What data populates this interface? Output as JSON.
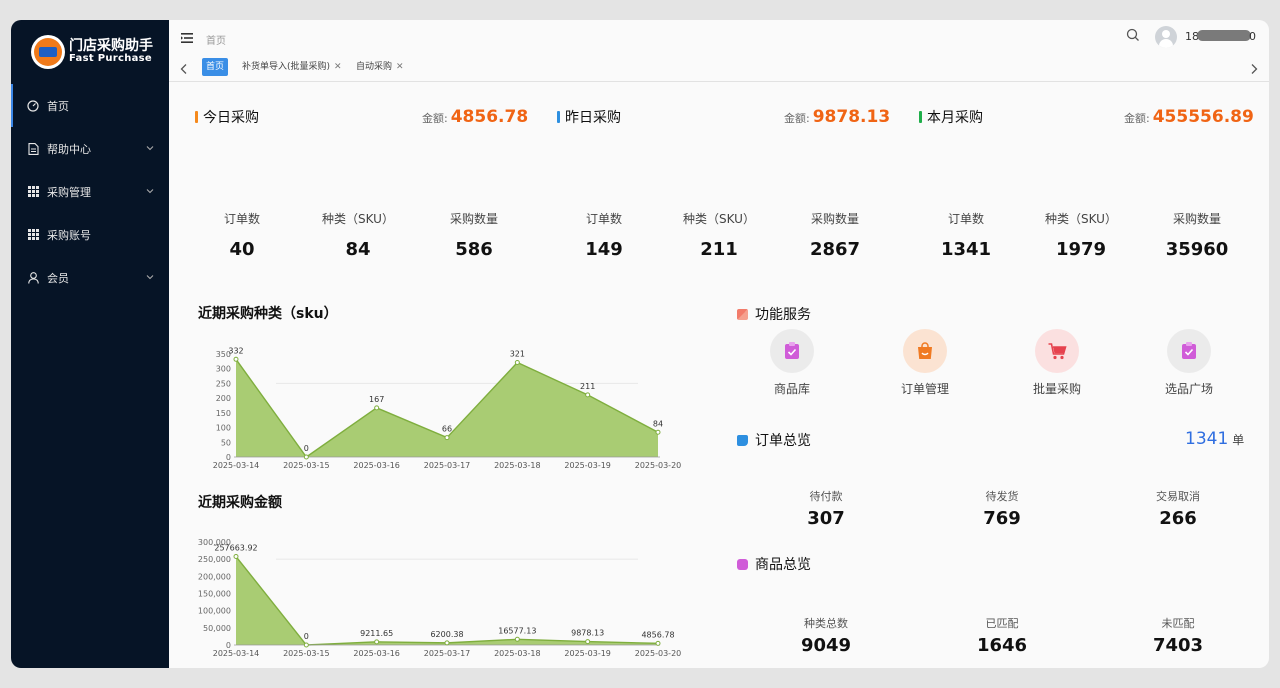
{
  "app": {
    "title_cn": "门店采购助手",
    "title_en": "Fast Purchase"
  },
  "sidebar": {
    "items": [
      {
        "label": "首页",
        "icon": "dashboard-icon",
        "active": true
      },
      {
        "label": "帮助中心",
        "icon": "document-icon",
        "active": false
      },
      {
        "label": "采购管理",
        "icon": "grid-icon",
        "active": false
      },
      {
        "label": "采购账号",
        "icon": "grid-icon",
        "active": false
      },
      {
        "label": "会员",
        "icon": "user-icon",
        "active": false
      }
    ]
  },
  "header": {
    "breadcrumb": "首页",
    "username_start": "18",
    "username_end": "0"
  },
  "tabs": [
    {
      "label": "首页",
      "active": true,
      "closable": false
    },
    {
      "label": "补货单导入(批量采购)",
      "active": false,
      "closable": true
    },
    {
      "label": "自动采购",
      "active": false,
      "closable": true
    }
  ],
  "stats": [
    {
      "title": "今日采购",
      "accent": "#f5891c",
      "amount_label": "金额:",
      "amount": "4856.78",
      "metrics": [
        {
          "label": "订单数",
          "value": "40"
        },
        {
          "label": "种类（SKU）",
          "value": "84"
        },
        {
          "label": "采购数量",
          "value": "586"
        }
      ]
    },
    {
      "title": "昨日采购",
      "accent": "#2d8fe0",
      "amount_label": "金额:",
      "amount": "9878.13",
      "metrics": [
        {
          "label": "订单数",
          "value": "149"
        },
        {
          "label": "种类（SKU）",
          "value": "211"
        },
        {
          "label": "采购数量",
          "value": "2867"
        }
      ]
    },
    {
      "title": "本月采购",
      "accent": "#1fae4a",
      "amount_label": "金额:",
      "amount": "455556.89",
      "metrics": [
        {
          "label": "订单数",
          "value": "1341"
        },
        {
          "label": "种类（SKU）",
          "value": "1979"
        },
        {
          "label": "采购数量",
          "value": "35960"
        }
      ]
    }
  ],
  "chart_data": [
    {
      "type": "area",
      "title": "近期采购种类（sku）",
      "categories": [
        "2025-03-14",
        "2025-03-15",
        "2025-03-16",
        "2025-03-17",
        "2025-03-18",
        "2025-03-19",
        "2025-03-20"
      ],
      "values": [
        332,
        0,
        167,
        66,
        321,
        211,
        84
      ],
      "value_labels": [
        "332",
        "0",
        "167",
        "66",
        "321",
        "211",
        "84"
      ],
      "ylim": [
        0,
        350
      ],
      "yticks": [
        0,
        50,
        100,
        150,
        200,
        250,
        300,
        350
      ],
      "ytick_labels": [
        "0",
        "50",
        "100",
        "150",
        "200",
        "250",
        "300",
        "350"
      ],
      "color": "#a9cc73"
    },
    {
      "type": "area",
      "title": "近期采购金额",
      "categories": [
        "2025-03-14",
        "2025-03-15",
        "2025-03-16",
        "2025-03-17",
        "2025-03-18",
        "2025-03-19",
        "2025-03-20"
      ],
      "values": [
        257663.92,
        0,
        9211.65,
        6200.38,
        16577.13,
        9878.13,
        4856.78
      ],
      "value_labels": [
        "257663.92",
        "0",
        "9211.65",
        "6200.38",
        "16577.13",
        "9878.13",
        "4856.78"
      ],
      "ylim": [
        0,
        300000
      ],
      "yticks": [
        0,
        50000,
        100000,
        150000,
        200000,
        250000,
        300000
      ],
      "ytick_labels": [
        "0",
        "50,000",
        "100,000",
        "150,000",
        "200,000",
        "250,000",
        "300,000"
      ],
      "color": "#a9cc73"
    }
  ],
  "services": {
    "title": "功能服务",
    "items": [
      {
        "label": "商品库",
        "icon": "product-library-icon",
        "bg": "#ebebeb",
        "fg": "#d05cd8"
      },
      {
        "label": "订单管理",
        "icon": "order-bag-icon",
        "bg": "#fbe3d2",
        "fg": "#f07a22"
      },
      {
        "label": "批量采购",
        "icon": "cart-icon",
        "bg": "#fbe0e0",
        "fg": "#e6424e"
      },
      {
        "label": "选品广场",
        "icon": "selection-icon",
        "bg": "#ebebeb",
        "fg": "#d05cd8"
      }
    ]
  },
  "orders": {
    "title": "订单总览",
    "total": "1341",
    "unit": "单",
    "items": [
      {
        "label": "待付款",
        "value": "307"
      },
      {
        "label": "待发货",
        "value": "769"
      },
      {
        "label": "交易取消",
        "value": "266"
      }
    ]
  },
  "products": {
    "title": "商品总览",
    "items": [
      {
        "label": "种类总数",
        "value": "9049"
      },
      {
        "label": "已匹配",
        "value": "1646"
      },
      {
        "label": "未匹配",
        "value": "7403"
      }
    ]
  }
}
